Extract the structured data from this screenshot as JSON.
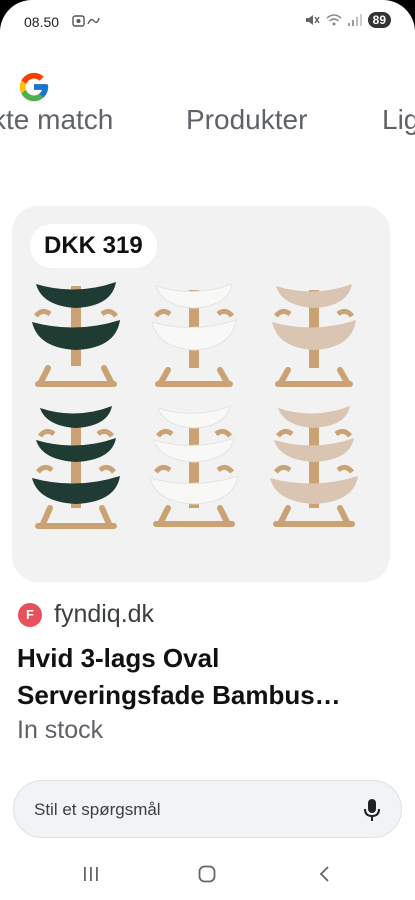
{
  "status_bar": {
    "time": "08.50",
    "battery": "89"
  },
  "icons": {
    "logo": "google-g-logo",
    "mic": "mic-icon",
    "recents": "recents-icon",
    "home": "home-icon",
    "back": "back-icon"
  },
  "tabs": [
    {
      "label": "kte match"
    },
    {
      "label": "Produkter"
    },
    {
      "label": "Lig"
    }
  ],
  "product": {
    "price": "DKK 319",
    "merchant_initial": "F",
    "merchant": "fyndiq.dk",
    "title": "Hvid 3-lags Oval Serveringsfade Bambus…",
    "stock": "In stock"
  },
  "ask": {
    "placeholder": "Stil et spørgsmål"
  },
  "colors": {
    "merchant_favicon": "#e8505b",
    "dark_green_bowl": "#1f3b33",
    "white_bowl": "#f4f4f2",
    "beige_bowl": "#d9c5b2",
    "bamboo": "#caa274"
  }
}
